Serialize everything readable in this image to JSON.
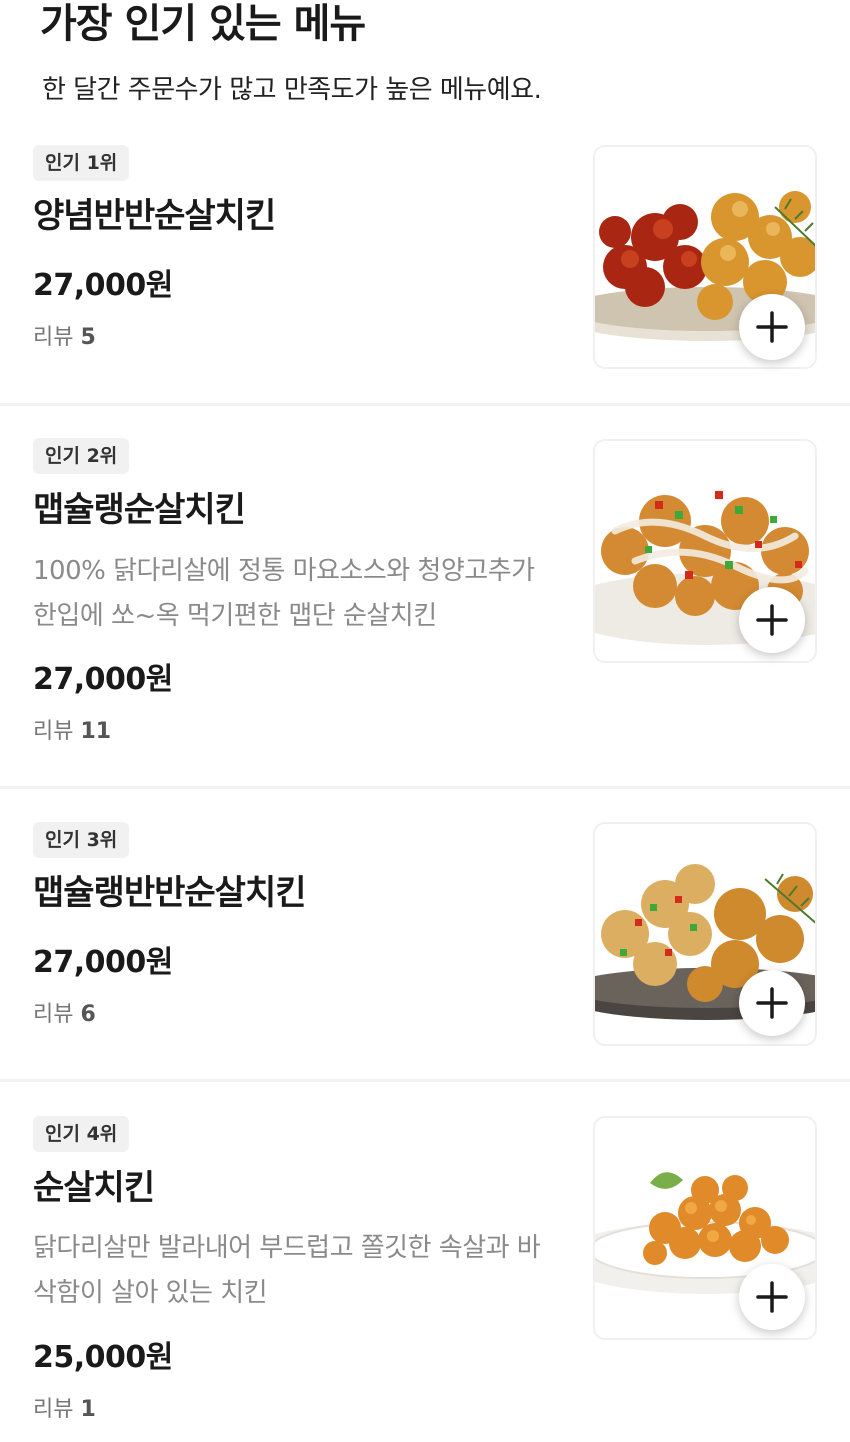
{
  "section": {
    "title": "가장 인기 있는 메뉴",
    "subtitle": "한 달간 주문수가 많고 만족도가 높은 메뉴예요."
  },
  "items": [
    {
      "rank": "인기 1위",
      "name": "양념반반순살치킨",
      "description": "",
      "price": "27,000원",
      "review_label": "리뷰",
      "review_count": "5",
      "image_icon": "yangnyeom-half-boneless-chicken-photo",
      "add_icon": "plus-icon"
    },
    {
      "rank": "인기 2위",
      "name": "맵슐랭순살치킨",
      "description": "100% 닭다리살에 정통 마요소스와 청양고추가 한입에 쏘~옥 먹기편한 맵단 순살치킨",
      "price": "27,000원",
      "review_label": "리뷰",
      "review_count": "11",
      "image_icon": "mapchelin-boneless-chicken-photo",
      "add_icon": "plus-icon"
    },
    {
      "rank": "인기 3위",
      "name": "맵슐랭반반순살치킨",
      "description": "",
      "price": "27,000원",
      "review_label": "리뷰",
      "review_count": "6",
      "image_icon": "mapchelin-half-boneless-chicken-photo",
      "add_icon": "plus-icon"
    },
    {
      "rank": "인기 4위",
      "name": "순살치킨",
      "description": "닭다리살만 발라내어 부드럽고 쫄깃한 속살과 바삭함이 살아 있는 치킨",
      "price": "25,000원",
      "review_label": "리뷰",
      "review_count": "1",
      "image_icon": "boneless-chicken-photo",
      "add_icon": "plus-icon"
    }
  ],
  "colors": {
    "text": "#1a1a1a",
    "muted": "#8a8a8a",
    "badge_bg": "#f1f1f1",
    "divider": "#f2f2f2",
    "sauce_red": "#b52a12",
    "fried_gold": "#d98f2b"
  }
}
